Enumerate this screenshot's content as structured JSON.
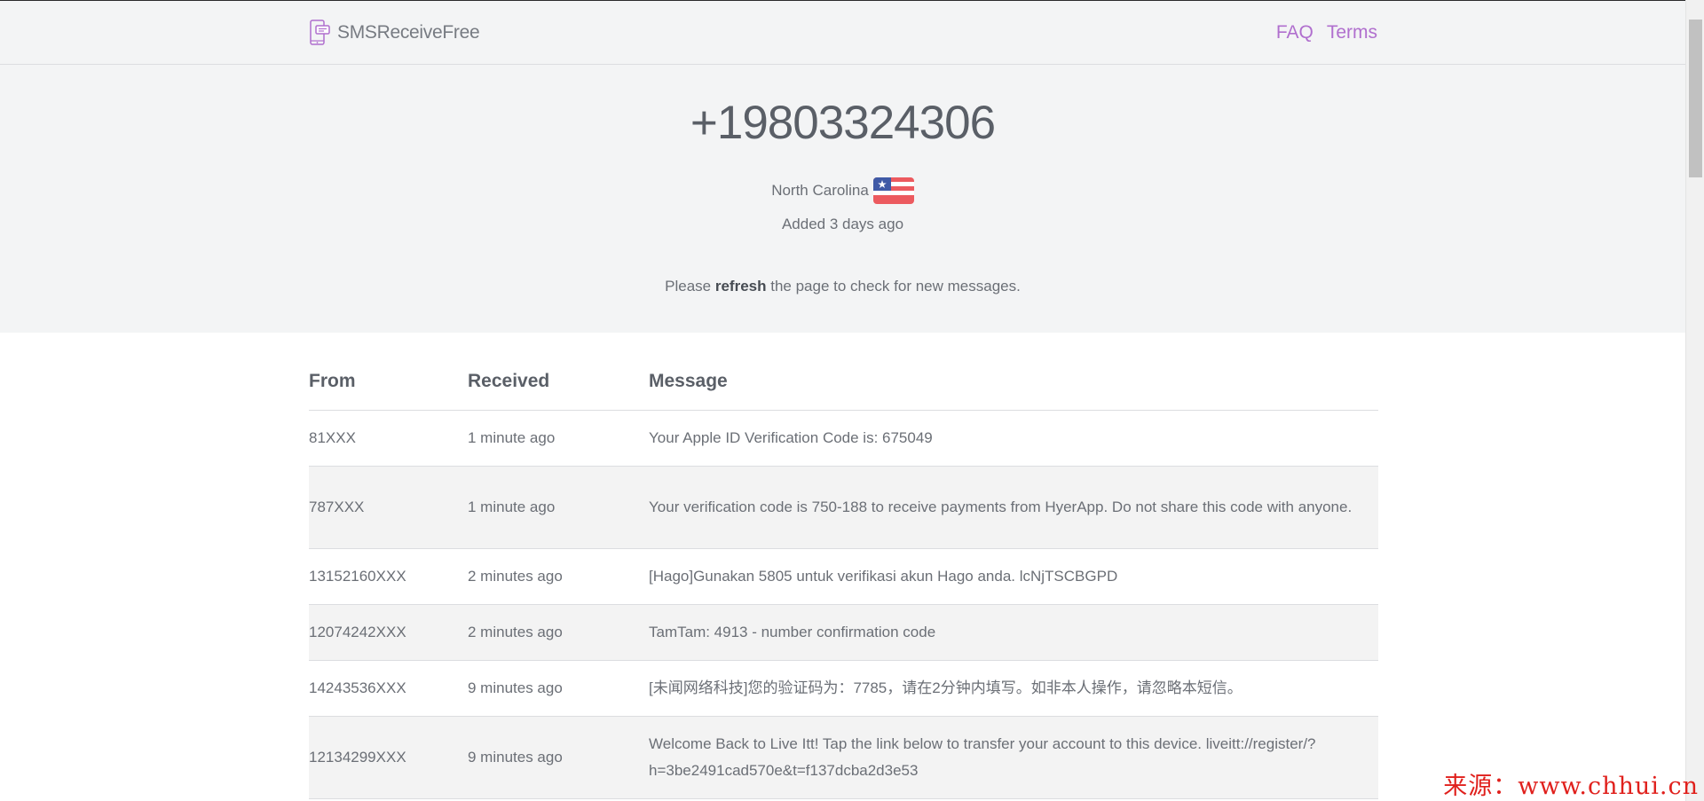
{
  "header": {
    "brand": "SMSReceiveFree",
    "nav": [
      {
        "label": "FAQ"
      },
      {
        "label": "Terms"
      }
    ]
  },
  "hero": {
    "phone_number": "+19803324306",
    "location": "North Carolina",
    "added": "Added 3 days ago",
    "refresh_before": "Please ",
    "refresh_bold": "refresh",
    "refresh_after": " the page to check for new messages."
  },
  "table": {
    "headers": {
      "from": "From",
      "received": "Received",
      "message": "Message"
    },
    "rows": [
      {
        "from": "81XXX",
        "received": "1 minute ago",
        "message": "Your Apple ID Verification Code is: 675049"
      },
      {
        "from": "787XXX",
        "received": "1 minute ago",
        "message": "Your verification code is 750-188 to receive payments from HyerApp. Do not share this code with anyone."
      },
      {
        "from": "13152160XXX",
        "received": "2 minutes ago",
        "message": "[Hago]Gunakan 5805 untuk verifikasi akun Hago anda. lcNjTSCBGPD"
      },
      {
        "from": "12074242XXX",
        "received": "2 minutes ago",
        "message": "TamTam: 4913 - number confirmation code"
      },
      {
        "from": "14243536XXX",
        "received": "9 minutes ago",
        "message": "[未闻网络科技]您的验证码为：7785，请在2分钟内填写。如非本人操作，请忽略本短信。"
      },
      {
        "from": "12134299XXX",
        "received": "9 minutes ago",
        "message": "Welcome Back to Live Itt! Tap the link below to transfer your account to this device. liveitt://register/?h=3be2491cad570e&t=f137dcba2d3e53"
      }
    ]
  },
  "watermark": "来源：www.chhui.cn",
  "icons": {
    "brand": "phone-message-icon",
    "flag": "us-flag-icon"
  },
  "colors": {
    "accent": "#b06fce",
    "hero_bg": "#f3f4f5",
    "row_alt_bg": "#f3f3f3",
    "watermark": "#e0201c"
  }
}
